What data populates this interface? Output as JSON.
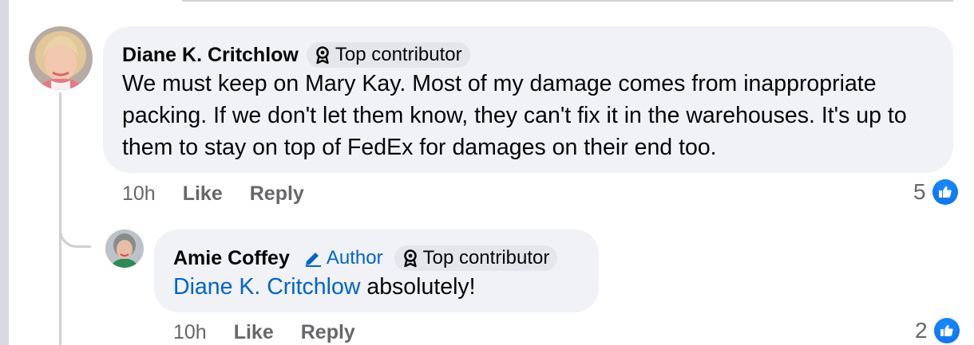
{
  "comments": [
    {
      "author": "Diane K. Critchlow",
      "badges": {
        "top": "Top contributor"
      },
      "text": "We must keep on Mary Kay. Most of my damage comes from inappropriate packing. If we don't let them know, they can't fix it in the warehouses. It's up to them to stay on top of FedEx for damages on their end too.",
      "time": "10h",
      "like_label": "Like",
      "reply_label": "Reply",
      "reaction_count": "5",
      "reaction_icon": "like-thumb-icon"
    },
    {
      "author": "Amie Coffey",
      "badges": {
        "author": "Author",
        "top": "Top contributor"
      },
      "mention": "Diane K. Critchlow",
      "text": "absolutely!",
      "time": "10h",
      "like_label": "Like",
      "reply_label": "Reply",
      "reaction_count": "2",
      "reaction_icon": "like-thumb-icon"
    }
  ],
  "colors": {
    "bubble": "#f0f2f5",
    "badge": "#e4e6eb",
    "link": "#0064d1",
    "meta": "#65676b",
    "like": "#0866ff"
  }
}
